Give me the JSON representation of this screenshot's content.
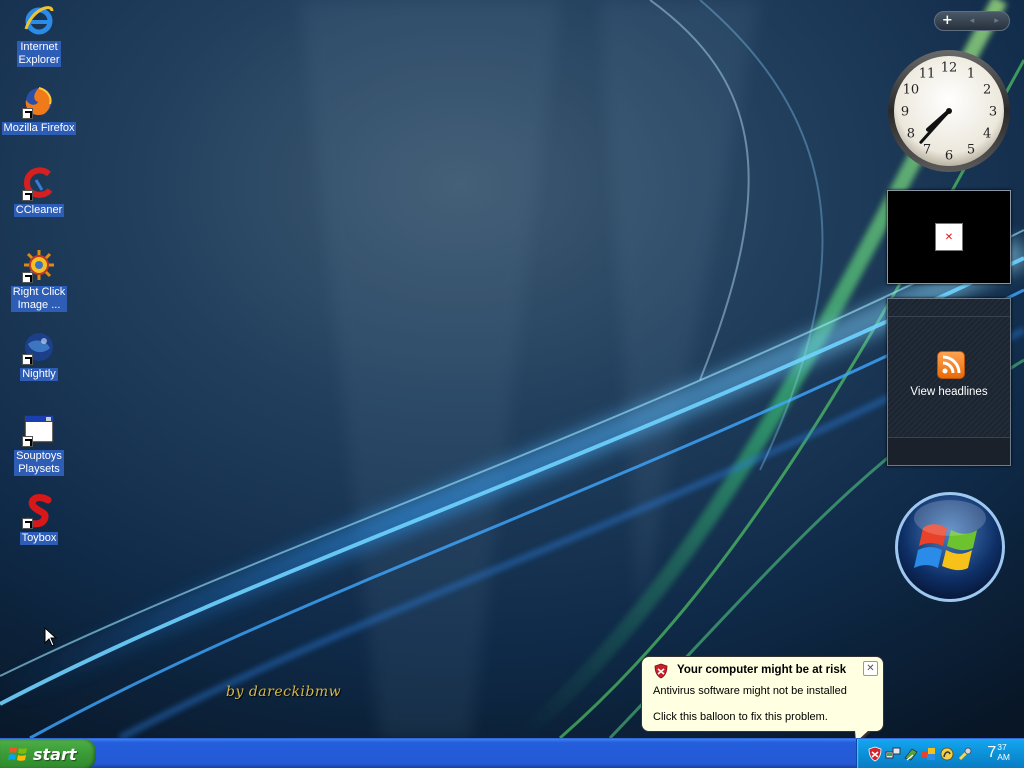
{
  "desktop": {
    "icons": [
      {
        "label": "Internet\nExplorer",
        "icon": "internet-explorer-icon"
      },
      {
        "label": "Mozilla Firefox",
        "icon": "firefox-icon"
      },
      {
        "label": "CCleaner",
        "icon": "ccleaner-icon"
      },
      {
        "label": "Right Click\nImage ...",
        "icon": "right-click-image-icon"
      },
      {
        "label": "Nightly",
        "icon": "nightly-icon"
      },
      {
        "label": "Souptoys\nPlaysets",
        "icon": "souptoys-icon"
      },
      {
        "label": "Toybox",
        "icon": "toybox-icon"
      }
    ],
    "signature": "by dareckibmw"
  },
  "sidebar": {
    "controls": {
      "add": "+",
      "prev": "◂",
      "next": "▸"
    },
    "clock": {
      "numerals": [
        "12",
        "1",
        "2",
        "3",
        "4",
        "5",
        "6",
        "7",
        "8",
        "9",
        "10",
        "11"
      ],
      "time": "7:37"
    },
    "feeds": {
      "label": "View headlines"
    }
  },
  "balloon": {
    "title": "Your computer might be at risk",
    "line1": "Antivirus software might not be installed",
    "line2": "Click this balloon to fix this problem.",
    "close": "✕"
  },
  "taskbar": {
    "start_label": "start",
    "clock": {
      "hour": "7",
      "minutes": "37",
      "ampm": "AM"
    }
  },
  "colors": {
    "taskbar_blue": "#245edc",
    "start_green": "#3c9c38",
    "tray_blue": "#0b91d8",
    "balloon_bg": "#ffffe1",
    "icon_label_highlight": "#2d5db5"
  }
}
